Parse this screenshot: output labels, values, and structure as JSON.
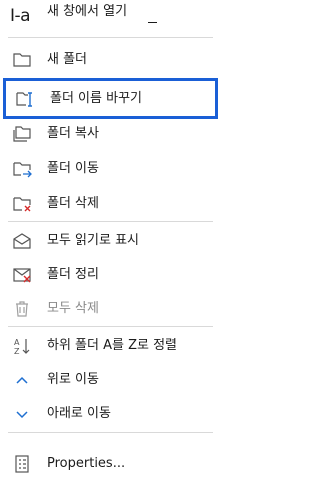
{
  "menu": {
    "top_item": {
      "icon_text": "I-a",
      "label": "새 창에서 열기"
    },
    "items": [
      {
        "label": "새 폴더",
        "icon": "new-folder-icon"
      },
      {
        "label": "폴더 이름 바꾸기",
        "icon": "rename-folder-icon"
      },
      {
        "label": "폴더 복사",
        "icon": "copy-folder-icon"
      },
      {
        "label": "폴더 이동",
        "icon": "move-folder-icon"
      },
      {
        "label": "폴더 삭제",
        "icon": "delete-folder-icon"
      },
      {
        "label": "모두 읽기로 표시",
        "icon": "mark-all-read-icon"
      },
      {
        "label": "폴더 정리",
        "icon": "clean-up-folder-icon"
      },
      {
        "label": "모두 삭제",
        "icon": "delete-all-icon"
      },
      {
        "label": "하위 폴더 A를 Z로 정렬",
        "icon": "sort-az-icon"
      },
      {
        "label": "위로 이동",
        "icon": "chevron-up-icon"
      },
      {
        "label": "아래로 이동",
        "icon": "chevron-down-icon"
      },
      {
        "label": "Properties...",
        "icon": "properties-icon"
      }
    ]
  },
  "colors": {
    "highlight_border": "#1a5fd6",
    "accent_blue": "#1f6fd1",
    "delete_red": "#d62b2b",
    "text": "#1b1b1b",
    "icon_gray": "#555555"
  }
}
